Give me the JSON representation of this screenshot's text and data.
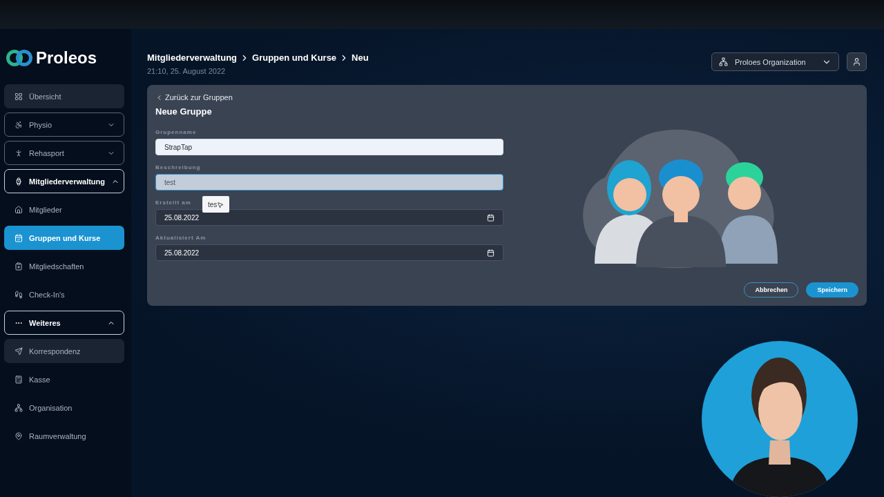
{
  "logo": {
    "name": "Proleos"
  },
  "sidebar": {
    "items": [
      {
        "kind": "item",
        "label": "Übersicht",
        "selected": false,
        "highlighted": true
      },
      {
        "kind": "group",
        "label": "Physio",
        "expanded": false
      },
      {
        "kind": "group",
        "label": "Rehasport",
        "expanded": false
      },
      {
        "kind": "group",
        "label": "Mitgliederverwaltung",
        "expanded": true
      },
      {
        "kind": "item",
        "label": "Mitglieder",
        "selected": false,
        "highlighted": false
      },
      {
        "kind": "item",
        "label": "Gruppen und Kurse",
        "selected": true,
        "highlighted": false
      },
      {
        "kind": "item",
        "label": "Mitgliedschaften",
        "selected": false,
        "highlighted": false
      },
      {
        "kind": "item",
        "label": "Check-In's",
        "selected": false,
        "highlighted": false
      },
      {
        "kind": "group",
        "label": "Weiteres",
        "expanded": true
      },
      {
        "kind": "item",
        "label": "Korrespondenz",
        "selected": false,
        "highlighted": true
      },
      {
        "kind": "item",
        "label": "Kasse",
        "selected": false,
        "highlighted": false
      },
      {
        "kind": "item",
        "label": "Organisation",
        "selected": false,
        "highlighted": false
      },
      {
        "kind": "item",
        "label": "Raumverwaltung",
        "selected": false,
        "highlighted": false
      }
    ]
  },
  "header": {
    "breadcrumb": [
      "Mitgliederverwaltung",
      "Gruppen und Kurse",
      "Neu"
    ],
    "timestamp": "21:10, 25. August 2022",
    "organization": "Proloes Organization"
  },
  "form": {
    "back_link": "Zurück zur Gruppen",
    "title": "Neue Gruppe",
    "fields": [
      {
        "kind": "text",
        "label": "Grupenname",
        "value": "StrapTap",
        "focused": false
      },
      {
        "kind": "text",
        "label": "Beschreibung",
        "value": "test",
        "focused": true,
        "suggestion": "tes"
      },
      {
        "kind": "date",
        "label": "Erstellt am",
        "value": "25.08.2022"
      },
      {
        "kind": "date",
        "label": "Aktualisiert Am",
        "value": "25.08.2022"
      }
    ],
    "buttons": [
      {
        "kind": "secondary",
        "label": "Abbrechen"
      },
      {
        "kind": "primary",
        "label": "Speichern"
      }
    ]
  }
}
